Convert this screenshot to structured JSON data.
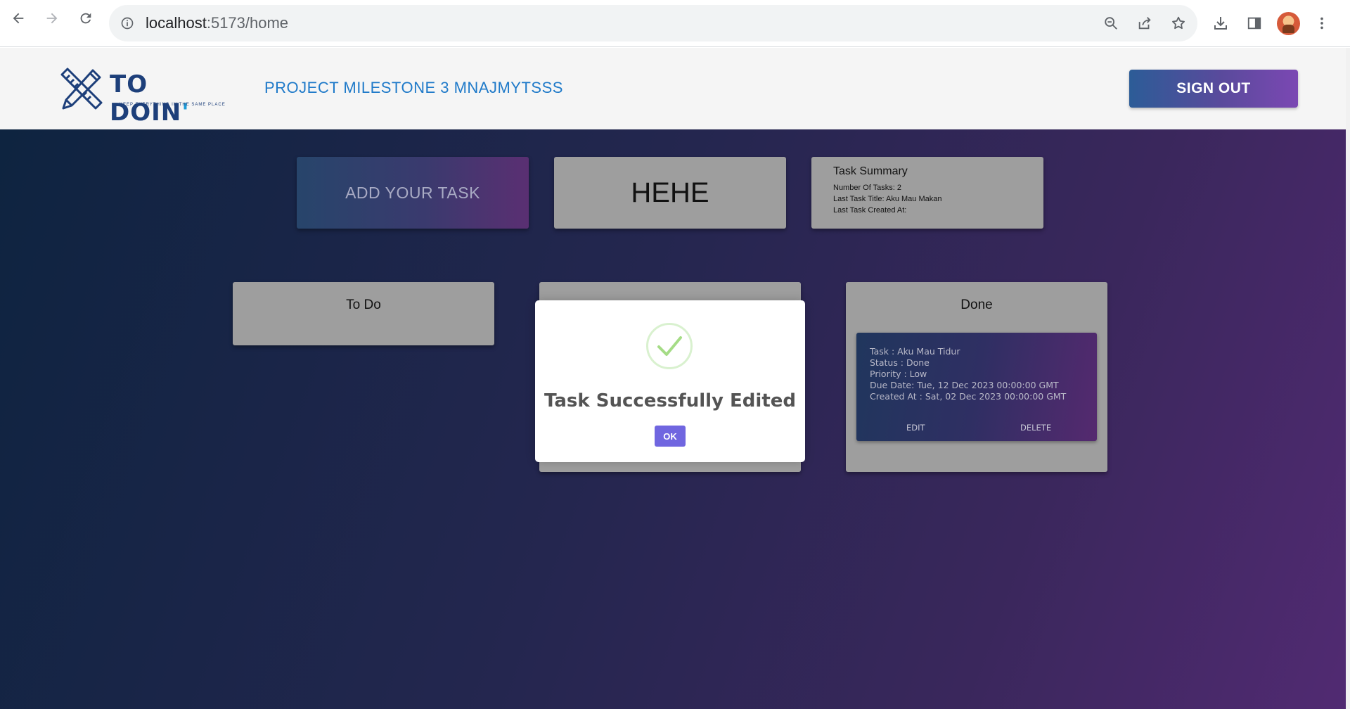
{
  "browser": {
    "url_host": "localhost",
    "url_path": ":5173/home"
  },
  "header": {
    "logo_text": "TO DOIN",
    "logo_apostrophe": "'",
    "logo_tagline": "KEEP EVERYTHING IN THE SAME PLACE",
    "project_title": "PROJECT MILESTONE 3 MNAJMYTSSS",
    "signout_label": "SIGN OUT"
  },
  "top_cards": {
    "add_task_label": "ADD YOUR TASK",
    "hehe_label": "HEHE",
    "summary": {
      "title": "Task Summary",
      "lines": [
        "Number Of Tasks: 2",
        "Last Task Title: Aku Mau Makan",
        "Last Task Created At:"
      ]
    }
  },
  "columns": {
    "todo_title": "To Do",
    "done_title": "Done"
  },
  "done_task": {
    "lines": [
      "Task : Aku Mau Tidur",
      "Status : Done",
      "Priority : Low",
      "Due Date: Tue, 12 Dec 2023 00:00:00 GMT",
      "Created At : Sat, 02 Dec 2023 00:00:00 GMT"
    ],
    "edit_label": "EDIT",
    "delete_label": "DELETE"
  },
  "modal": {
    "title": "Task Successfully Edited",
    "ok_label": "OK",
    "icon": "success-check-icon",
    "accent_color": "#7066e0",
    "check_color": "#a5dc86"
  }
}
